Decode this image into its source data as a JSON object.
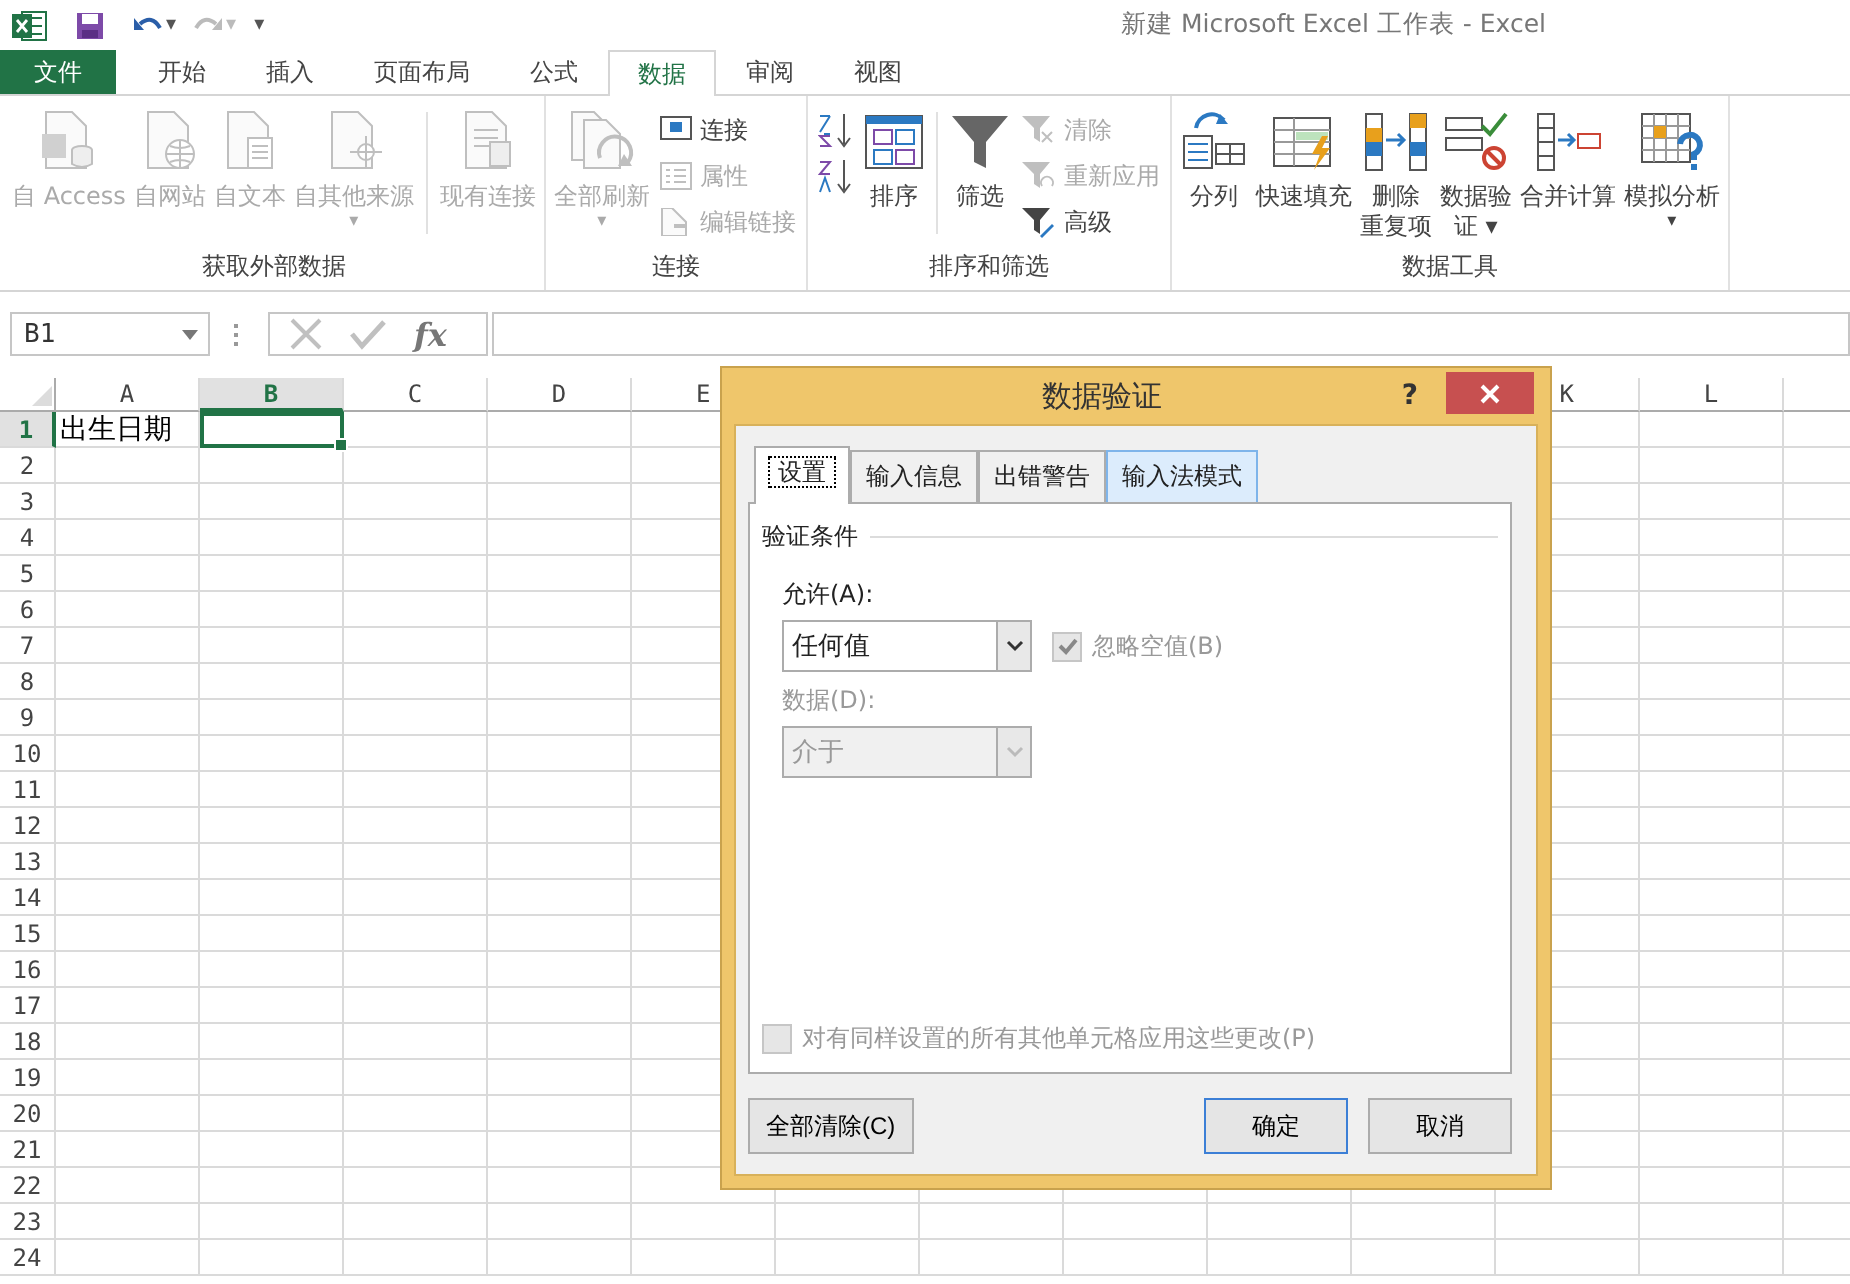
{
  "quick_access": {
    "title": "新建 Microsoft Excel 工作表 - Excel",
    "customize": "▾",
    "undo_caret": "▾",
    "redo_caret": "▾",
    "redo_disabled": true
  },
  "tabs": [
    {
      "label": "文件",
      "kind": "file",
      "selected": false
    },
    {
      "label": "开始",
      "kind": "tab",
      "selected": false
    },
    {
      "label": "插入",
      "kind": "tab",
      "selected": false
    },
    {
      "label": "页面布局",
      "kind": "tab",
      "selected": false
    },
    {
      "label": "公式",
      "kind": "tab",
      "selected": false
    },
    {
      "label": "数据",
      "kind": "tab",
      "selected": true
    },
    {
      "label": "审阅",
      "kind": "tab",
      "selected": false
    },
    {
      "label": "视图",
      "kind": "tab",
      "selected": false
    }
  ],
  "ribbon": {
    "groups": [
      {
        "label": "获取外部数据",
        "items": [
          {
            "kind": "large",
            "lines": [
              "自 Access"
            ],
            "disabled": true
          },
          {
            "kind": "large",
            "lines": [
              "自网站"
            ],
            "disabled": true
          },
          {
            "kind": "large",
            "lines": [
              "自文本"
            ],
            "disabled": true
          },
          {
            "kind": "large",
            "lines": [
              "自其他来源"
            ],
            "caret": "▾",
            "disabled": true
          },
          {
            "kind": "large",
            "lines": [
              "现有连接"
            ],
            "disabled": true,
            "separator_before": true
          }
        ]
      },
      {
        "label": "连接",
        "items": [
          {
            "kind": "large",
            "lines": [
              "全部刷新"
            ],
            "caret": "▾",
            "disabled": true
          },
          {
            "kind": "stack",
            "items": [
              {
                "label": "连接",
                "disabled": false
              },
              {
                "label": "属性",
                "disabled": true
              },
              {
                "label": "编辑链接",
                "disabled": true
              }
            ]
          }
        ]
      },
      {
        "label": "排序和筛选",
        "items": [
          {
            "kind": "stack",
            "items": [
              {
                "disabled": false
              },
              {
                "disabled": false
              }
            ]
          },
          {
            "kind": "large",
            "lines": [
              "排序"
            ],
            "disabled": false
          },
          {
            "kind": "large",
            "lines": [
              "筛选"
            ],
            "disabled": false,
            "separator_before": true
          },
          {
            "kind": "stack",
            "items": [
              {
                "label": "清除",
                "disabled": true
              },
              {
                "label": "重新应用",
                "disabled": true
              },
              {
                "label": "高级",
                "disabled": false
              }
            ]
          }
        ]
      },
      {
        "label": "数据工具",
        "items": [
          {
            "kind": "large",
            "lines": [
              "分列"
            ],
            "disabled": false
          },
          {
            "kind": "large",
            "lines": [
              "快速填充"
            ],
            "disabled": false
          },
          {
            "kind": "large",
            "lines": [
              "删除",
              "重复项"
            ],
            "disabled": false
          },
          {
            "kind": "large",
            "lines": [
              "数据验",
              "证"
            ],
            "caret": "▾",
            "disabled": false
          },
          {
            "kind": "large",
            "lines": [
              "合并计算"
            ],
            "disabled": false
          },
          {
            "kind": "large",
            "lines": [
              "模拟分析"
            ],
            "caret": "▾",
            "disabled": false
          }
        ]
      }
    ]
  },
  "formula_bar": {
    "name_box": "B1",
    "fx": "fx",
    "enter_disabled": true
  },
  "sheet": {
    "columns_left": [
      {
        "label": "A",
        "selected": false
      },
      {
        "label": "B",
        "selected": true
      },
      {
        "label": "C",
        "selected": false
      },
      {
        "label": "D",
        "selected": false
      },
      {
        "label": "E",
        "selected": false
      }
    ],
    "columns_right": [
      {
        "label": "K",
        "selected": false
      },
      {
        "label": "L",
        "selected": false
      }
    ],
    "rows": [
      {
        "header": "1",
        "selected": true,
        "cells": [
          {
            "text": "出生日期",
            "selected": false
          },
          {
            "selected": true
          }
        ]
      },
      {
        "header": "2",
        "selected": false
      },
      {
        "header": "3",
        "selected": false
      },
      {
        "header": "4",
        "selected": false
      },
      {
        "header": "5",
        "selected": false
      },
      {
        "header": "6",
        "selected": false
      },
      {
        "header": "7",
        "selected": false
      },
      {
        "header": "8",
        "selected": false
      },
      {
        "header": "9",
        "selected": false
      },
      {
        "header": "10",
        "selected": false
      },
      {
        "header": "11",
        "selected": false
      },
      {
        "header": "12",
        "selected": false
      },
      {
        "header": "13",
        "selected": false
      },
      {
        "header": "14",
        "selected": false
      },
      {
        "header": "15",
        "selected": false
      },
      {
        "header": "16",
        "selected": false
      },
      {
        "header": "17",
        "selected": false
      },
      {
        "header": "18",
        "selected": false
      },
      {
        "header": "19",
        "selected": false
      },
      {
        "header": "20",
        "selected": false
      },
      {
        "header": "21",
        "selected": false
      },
      {
        "header": "22",
        "selected": false
      },
      {
        "header": "23",
        "selected": false
      },
      {
        "header": "24",
        "selected": false
      }
    ]
  },
  "dialog": {
    "title": "数据验证",
    "help": "?",
    "tabs": [
      {
        "label": "设置",
        "selected": true,
        "hovered": false
      },
      {
        "label": "输入信息",
        "selected": false,
        "hovered": false
      },
      {
        "label": "出错警告",
        "selected": false,
        "hovered": false
      },
      {
        "label": "输入法模式",
        "selected": false,
        "hovered": true
      }
    ],
    "section": "验证条件",
    "allow": {
      "label": "允许(A):",
      "value": "任何值",
      "disabled": false
    },
    "ignore_blank": {
      "label": "忽略空值(B)",
      "checked": true,
      "disabled": true
    },
    "data": {
      "label": "数据(D):",
      "value": "介于",
      "disabled": true
    },
    "apply_all": {
      "label": "对有同样设置的所有其他单元格应用这些更改(P)",
      "checked": false,
      "disabled": true
    },
    "buttons": [
      {
        "label": "全部清除(C)",
        "kind": "left",
        "default": false
      },
      {
        "label": "确定",
        "kind": "right",
        "default": true
      },
      {
        "label": "取消",
        "kind": "right",
        "default": false
      }
    ]
  }
}
